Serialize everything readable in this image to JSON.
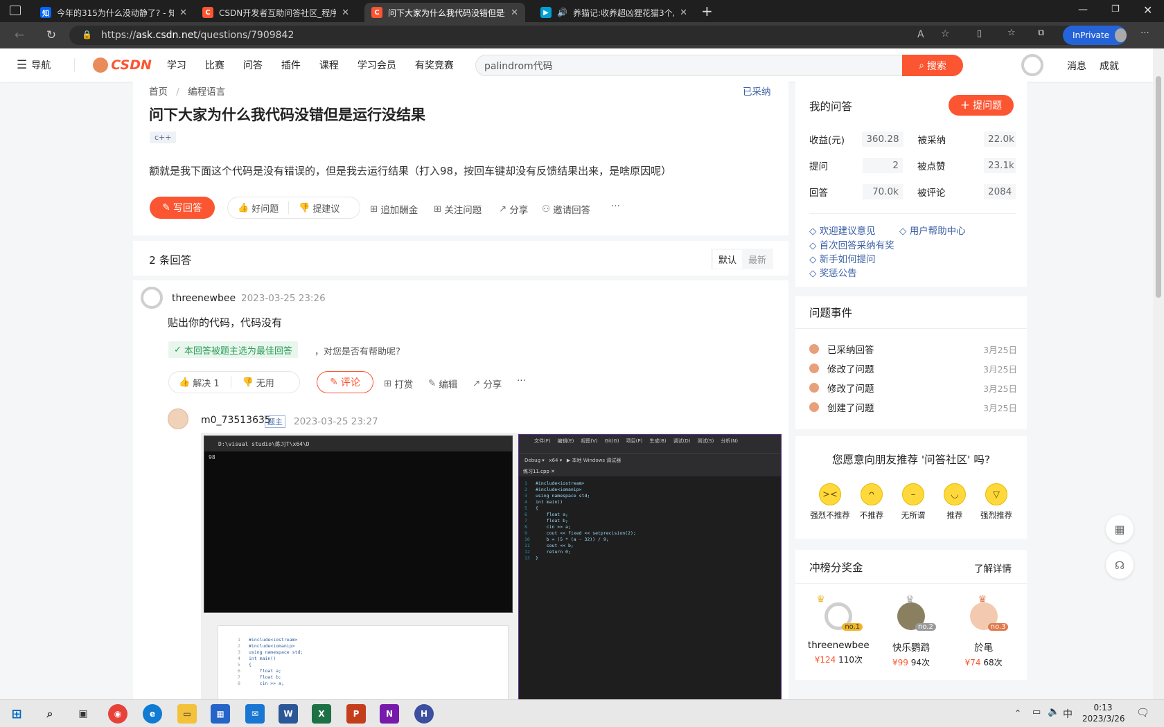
{
  "tabs": [
    {
      "title": "今年的315为什么没动静了? - 知",
      "favicon": "知",
      "color": "#0066ff"
    },
    {
      "title": "CSDN开发者互助问答社区_程序",
      "favicon": "C",
      "color": "#fc5531"
    },
    {
      "title": "问下大家为什么我代码没错但是运",
      "favicon": "C",
      "color": "#fc5531"
    },
    {
      "title": "养猫记:收养超凶狸花猫3个月",
      "favicon": "▶",
      "color": "#00a1d6"
    }
  ],
  "url": {
    "prefix": "https://",
    "host": "ask.csdn.net",
    "path": "/questions/7909842"
  },
  "inprivate": "InPrivate",
  "header": {
    "nav_label": "导航",
    "logo": "CSDN",
    "links": [
      "学习",
      "比赛",
      "问答",
      "插件",
      "课程",
      "学习会员",
      "有奖竞赛"
    ],
    "search_value": "palindrom代码",
    "search_btn": "搜索",
    "right": [
      "消息",
      "成就"
    ]
  },
  "question": {
    "breadcrumb": [
      "首页",
      "编程语言"
    ],
    "status": "已采纳",
    "title": "问下大家为什么我代码没错但是运行没结果",
    "tag": "c++",
    "body": "额就是我下面这个代码是没有错误的，但是我去运行结果（打入98，按回车键却没有反馈结果出来，是啥原因呢）",
    "write_btn": "写回答",
    "good": "好问题",
    "suggest": "提建议",
    "actions": [
      "追加酬金",
      "关注问题",
      "分享",
      "邀请回答"
    ],
    "more": "···"
  },
  "answers_bar": {
    "count": "2 条回答",
    "sort": [
      "默认",
      "最新"
    ]
  },
  "answer": {
    "user": "threenewbee",
    "time": "2023-03-25 23:26",
    "text": "贴出你的代码，代码没有",
    "best_badge": "本回答被题主选为最佳回答",
    "best_suffix": "，对您是否有帮助呢?",
    "solve": "解决 1",
    "useless": "无用",
    "comment": "评论",
    "actions": [
      "打赏",
      "编辑",
      "分享"
    ],
    "more": "···"
  },
  "comment": {
    "user": "m0_73513635",
    "role": "题主",
    "time": "2023-03-25 23:27",
    "console_title": "D:\\visual studio\\练习T\\x64\\D",
    "console_output": "98",
    "code_lines": [
      "#include<iostream>",
      "#include<iomanip>",
      "using namespace std;",
      "int main()",
      "{",
      "    float a;",
      "    float b;",
      "    cin >> a;",
      "    cout << fixed << setprecision(2);",
      "    b = (5 * (a - 32)) / 9;",
      "    cout << b;",
      "    return 0;",
      "}"
    ],
    "ide_file": "练习11.cpp",
    "ide_menu": [
      "文件(F)",
      "编辑(E)",
      "视图(V)",
      "Git(G)",
      "项目(P)",
      "生成(B)",
      "调试(D)",
      "测试(S)",
      "分析(N)"
    ]
  },
  "sidebar": {
    "my_q_title": "我的问答",
    "ask_btn": "提问题",
    "stats": [
      {
        "label": "收益(元)",
        "value": "360.28",
        "label2": "被采纳",
        "value2": "22.0k"
      },
      {
        "label": "提问",
        "value": "2",
        "label2": "被点赞",
        "value2": "23.1k"
      },
      {
        "label": "回答",
        "value": "70.0k",
        "label2": "被评论",
        "value2": "2084"
      }
    ],
    "links": [
      "欢迎建议意见",
      "用户帮助中心",
      "首次回答采纳有奖",
      "新手如何提问",
      "奖惩公告"
    ],
    "events_title": "问题事件",
    "events": [
      {
        "text": "已采纳回答",
        "date": "3月25日"
      },
      {
        "text": "修改了问题",
        "date": "3月25日"
      },
      {
        "text": "修改了问题",
        "date": "3月25日"
      },
      {
        "text": "创建了问题",
        "date": "3月25日"
      }
    ],
    "recommend_q": "您愿意向朋友推荐 '问答社区' 吗?",
    "recommend_opts": [
      "强烈不推荐",
      "不推荐",
      "无所谓",
      "推荐",
      "强烈推荐"
    ],
    "rank_title": "冲榜分奖金",
    "rank_more": "了解详情",
    "rank": [
      {
        "name": "threenewbee",
        "amount": "¥124",
        "count": "110次",
        "no": "no.1"
      },
      {
        "name": "快乐鹦鹉",
        "amount": "¥99",
        "count": "94次",
        "no": "no.2"
      },
      {
        "name": "於黾",
        "amount": "¥74",
        "count": "68次",
        "no": "no.3"
      }
    ]
  },
  "taskbar": {
    "time": "0:13",
    "date": "2023/3/26",
    "ime": "中"
  }
}
